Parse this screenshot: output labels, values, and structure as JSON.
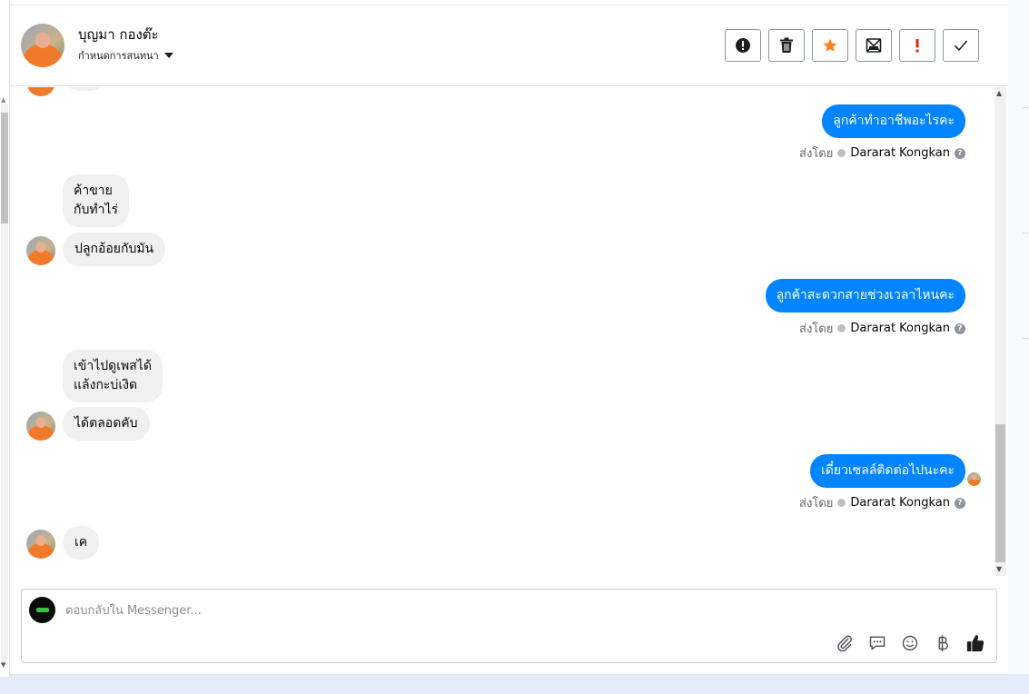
{
  "contact": {
    "name": "บุญมา กองต๊ะ",
    "subtitle": "กำหนดการสนทนา"
  },
  "actions": [
    {
      "name": "important-icon",
      "color": "#1c1e21"
    },
    {
      "name": "trash-icon",
      "color": "#1c1e21"
    },
    {
      "name": "star-icon",
      "color": "#f5821f"
    },
    {
      "name": "mark-unread-icon",
      "color": "#1c1e21"
    },
    {
      "name": "spam-icon",
      "color": "#d8290f"
    },
    {
      "name": "done-check-icon",
      "color": "#1c1e21"
    }
  ],
  "sent_by_label": "ส่งโดย",
  "agent_name": "Dararat Kongkan",
  "messages": {
    "out1": "ลูกค้าทำอาชีพอะไรคะ",
    "in1a_line1": "ค้าขาย",
    "in1a_line2": "กับทำไร่",
    "in1b": "ปลูกอ้อยกับมัน",
    "out2": "ลูกค้าสะดวกสายช่วงเวลาไหนคะ",
    "in2a_line1": "เข้าไปดูเพสได้",
    "in2a_line2": "แล้งกะบ่เงิด",
    "in2b": "ได้ตลอดคับ",
    "out3": "เดี๋ยวเซลล์ติดต่อไปนะคะ",
    "in3": "เค"
  },
  "composer": {
    "placeholder": "ตอบกลับใน Messenger..."
  },
  "colors": {
    "outgoing_bubble": "#0084ff",
    "incoming_bubble": "#f0f0f0",
    "like_icon": "#1c1e21"
  },
  "tools": [
    "attach-icon",
    "saved-reply-icon",
    "emoji-icon",
    "baht-payment-icon",
    "like-icon"
  ]
}
